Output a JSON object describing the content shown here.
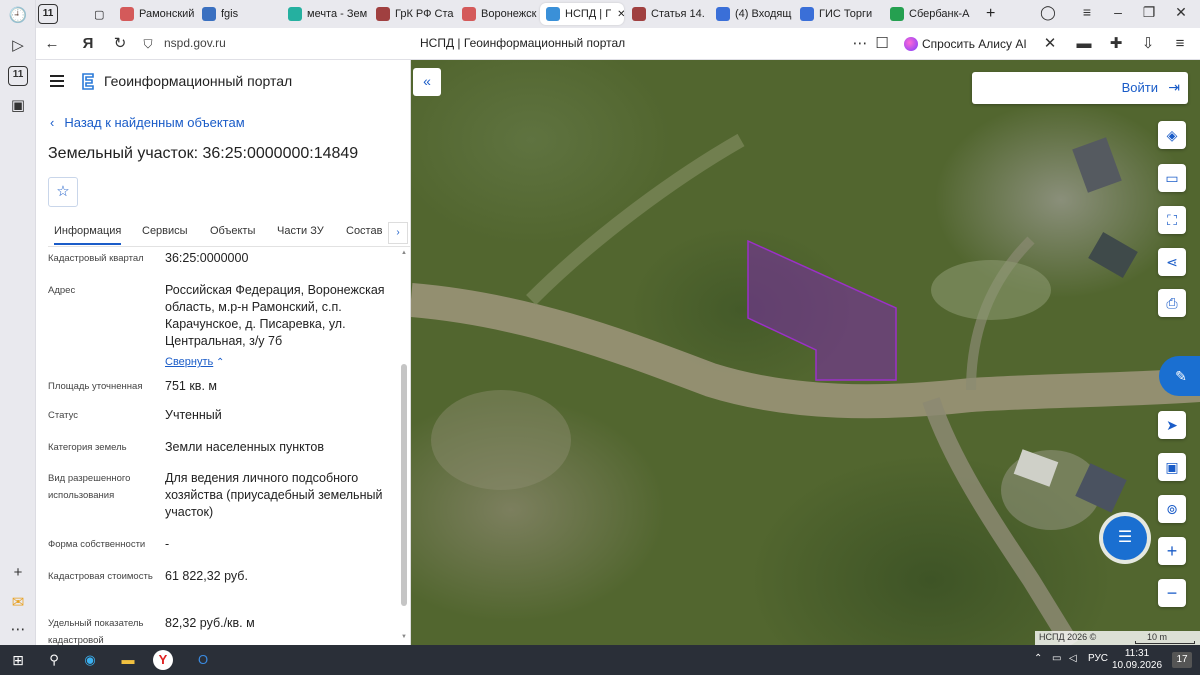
{
  "browser": {
    "tab_count": "11",
    "tabs": [
      {
        "label": "Рамонский",
        "color": "#d45a5a"
      },
      {
        "label": "fgis",
        "color": "#3a70c0"
      },
      {
        "label": "мечта - Зем",
        "color": "#25b0a0"
      },
      {
        "label": "ГрК РФ Ста",
        "color": "#a04040"
      },
      {
        "label": "Воронежск",
        "color": "#d45a5a"
      },
      {
        "label": "НСПД | Г",
        "color": "#3a90d8"
      },
      {
        "label": "Статья 14. С",
        "color": "#a04040"
      },
      {
        "label": "(4) Входящ",
        "color": "#3a6fd8"
      },
      {
        "label": "ГИС Торги",
        "color": "#3a6fd8"
      },
      {
        "label": "Сбербанк-А",
        "color": "#25a050"
      }
    ],
    "url": "nspd.gov.ru",
    "page_title": "НСПД | Геоинформационный портал",
    "alice_label": "Спросить Алису AI",
    "sidebar_badge": "11"
  },
  "panel": {
    "portal_title": "Геоинформационный портал",
    "back_label": "Назад к найденным объектам",
    "title": "Земельный участок: 36:25:0000000:14849",
    "tabs": [
      "Информация",
      "Сервисы",
      "Объекты",
      "Части ЗУ",
      "Состав"
    ],
    "rows": [
      {
        "label": "Кадастровый квартал",
        "value": "36:25:0000000"
      },
      {
        "label": "Адрес",
        "value": "Российская Федерация, Воронежская область, м.р-н Рамонский, с.п. Карачунское, д. Писаревка, ул. Центральная, з/у 7б",
        "collapse": "Свернуть"
      },
      {
        "label": "Площадь уточненная",
        "value": "751 кв. м"
      },
      {
        "label": "Статус",
        "value": "Учтенный"
      },
      {
        "label": "Категория земель",
        "value": "Земли населенных пунктов"
      },
      {
        "label": "Вид разрешенного использования",
        "value": "Для ведения личного подсобного хозяйства (приусадебный земельный участок)"
      },
      {
        "label": "Форма собственности",
        "value": "-"
      },
      {
        "label": "Кадастровая стоимость",
        "value": "61 822,32 руб."
      },
      {
        "label": "Удельный показатель кадастровой",
        "value": "82,32 руб./кв. м"
      }
    ]
  },
  "map": {
    "login_label": "Войти",
    "attribution": "НСПД 2026 ©",
    "scale_label": "10 m",
    "parcel_color": "#9b30c8"
  },
  "taskbar": {
    "lang": "РУС",
    "time": "11:31",
    "date": "10.09.2026",
    "notif": "17"
  }
}
